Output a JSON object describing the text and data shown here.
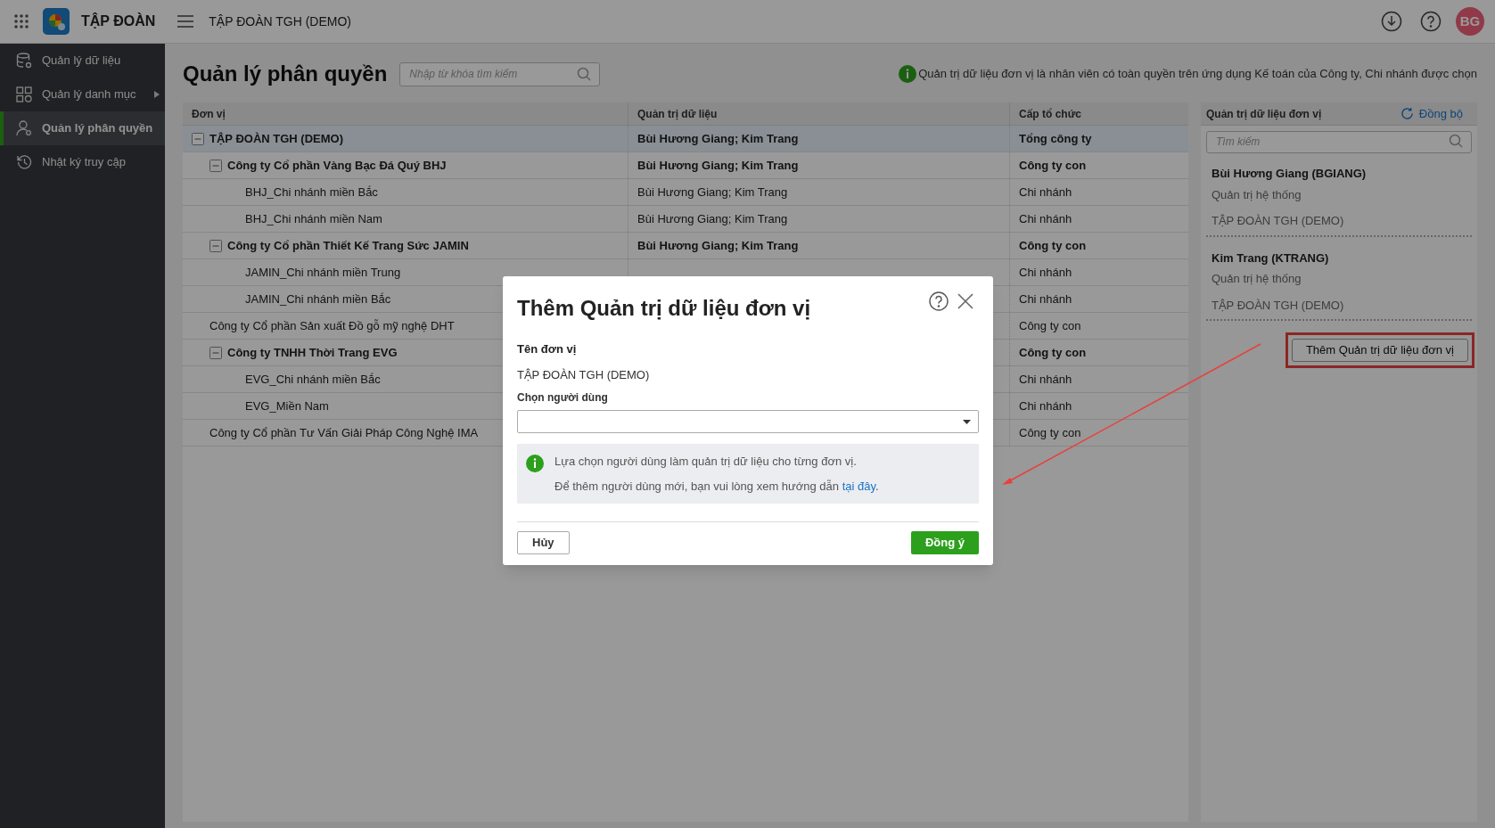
{
  "top_bar": {
    "app_name": "TẬP ĐOÀN",
    "org_name": "TẬP ĐOÀN TGH (DEMO)",
    "avatar_initials": "BG"
  },
  "sidebar": {
    "items": [
      {
        "label": "Quản lý dữ liệu",
        "kind": "database",
        "selected": false,
        "has_submenu": false
      },
      {
        "label": "Quản lý danh mục",
        "kind": "grid",
        "selected": false,
        "has_submenu": true
      },
      {
        "label": "Quản lý phân quyền",
        "kind": "user",
        "selected": true,
        "has_submenu": false
      },
      {
        "label": "Nhật ký truy cập",
        "kind": "history",
        "selected": false,
        "has_submenu": false
      }
    ]
  },
  "page": {
    "title": "Quản lý phân quyền",
    "search": {
      "placeholder": "Nhập từ khóa tìm kiếm"
    },
    "notice": "Quản trị dữ liệu đơn vị là nhân viên có toàn quyền trên ứng dụng Kế toán của Công ty, Chi nhánh được chọn"
  },
  "table": {
    "columns": [
      "Đơn vị",
      "Quản trị dữ liệu",
      "Cấp tổ chức"
    ],
    "rows": [
      {
        "unit": "TẬP ĐOÀN TGH (DEMO)",
        "admins": "Bùi Hương Giang; Kim Trang",
        "level": "Tổng công ty",
        "selected": true,
        "expanded": true,
        "children": [
          {
            "unit": "Công ty Cổ phần Vàng Bạc Đá Quý BHJ",
            "admins": "Bùi Hương Giang; Kim Trang",
            "level": "Công ty con",
            "selected": false,
            "expanded": true,
            "children": [
              {
                "unit": "BHJ_Chi nhánh miền Bắc",
                "admins": "Bùi Hương Giang; Kim Trang",
                "level": "Chi nhánh",
                "selected": false
              },
              {
                "unit": "BHJ_Chi nhánh miền Nam",
                "admins": "Bùi Hương Giang; Kim Trang",
                "level": "Chi nhánh",
                "selected": false
              }
            ]
          },
          {
            "unit": "Công ty Cổ phần Thiết Kế Trang Sức JAMIN",
            "admins": "Bùi Hương Giang; Kim Trang",
            "level": "Công ty con",
            "selected": false,
            "expanded": true,
            "children": [
              {
                "unit": "JAMIN_Chi nhánh miền Trung",
                "level": "Chi nhánh",
                "selected": false
              },
              {
                "unit": "JAMIN_Chi nhánh miền Bắc",
                "level": "Chi nhánh",
                "selected": false
              }
            ]
          },
          {
            "unit": "Công ty Cổ phần Sản xuất Đồ gỗ mỹ nghệ DHT",
            "level": "Công ty con",
            "selected": false
          },
          {
            "unit": "Công ty TNHH Thời Trang EVG",
            "level": "Công ty con",
            "selected": false,
            "expanded": true,
            "children": [
              {
                "unit": "EVG_Chi nhánh miền Bắc",
                "level": "Chi nhánh",
                "selected": false
              },
              {
                "unit": "EVG_Miền Nam",
                "level": "Chi nhánh",
                "selected": false
              }
            ]
          },
          {
            "unit": "Công ty Cổ phần Tư Vấn Giải Pháp Công Nghệ IMA",
            "level": "Công ty con",
            "selected": false
          }
        ]
      }
    ]
  },
  "admin_panel": {
    "title": "Quản trị dữ liệu đơn vị",
    "sync_label": "Đồng bộ",
    "search": {
      "placeholder": "Tìm kiếm"
    },
    "admins": [
      {
        "name": "Bùi Hương Giang (BGIANG)",
        "role": "Quản trị hệ thống",
        "unit": "TẬP ĐOÀN TGH (DEMO)"
      },
      {
        "name": "Kim Trang (KTRANG)",
        "role": "Quản trị hệ thống",
        "unit": "TẬP ĐOÀN TGH (DEMO)"
      }
    ],
    "add_button": "Thêm Quản trị dữ liệu đơn vị"
  },
  "dialog": {
    "title": "Thêm Quản trị dữ liệu đơn vị",
    "unit_label": "Tên đơn vị",
    "unit_value": "TẬP ĐOÀN TGH (DEMO)",
    "user_label": "Chọn người dùng",
    "info_text": "Lựa chọn người dùng làm quản trị dữ liệu cho từng đơn vị.",
    "guide": {
      "text": "Để thêm người dùng mới, bạn vui lòng xem hướng dẫn",
      "link": "tại đây",
      "end": "."
    },
    "cancel_button": "Hủy",
    "confirm_button": "Đồng ý"
  }
}
